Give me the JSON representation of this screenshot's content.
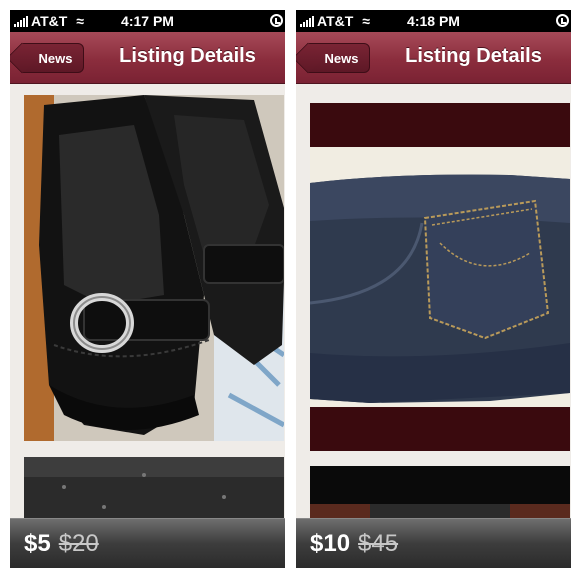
{
  "screens": [
    {
      "status": {
        "carrier": "AT&T",
        "time": "4:17 PM"
      },
      "nav": {
        "back_label": "News",
        "title": "Listing Details"
      },
      "photo_main": "black leather loafer shoes with silver buckle",
      "photo_next": "partially visible next photo",
      "price": {
        "current": "$5",
        "original": "$20"
      }
    },
    {
      "status": {
        "carrier": "AT&T",
        "time": "4:18 PM"
      },
      "nav": {
        "back_label": "News",
        "title": "Listing Details"
      },
      "photo_main": "dark denim jeans back pocket",
      "photo_next": "partially visible next photo",
      "price": {
        "current": "$10",
        "original": "$45"
      }
    }
  ]
}
